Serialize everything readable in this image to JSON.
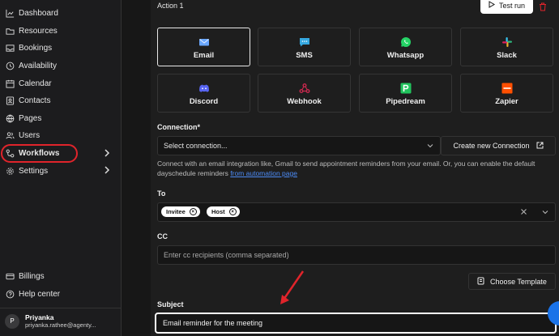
{
  "sidebar": {
    "items": [
      {
        "label": "Dashboard",
        "icon": "chart-icon"
      },
      {
        "label": "Resources",
        "icon": "folder-icon"
      },
      {
        "label": "Bookings",
        "icon": "inbox-icon"
      },
      {
        "label": "Availability",
        "icon": "clock-icon"
      },
      {
        "label": "Calendar",
        "icon": "calendar-icon"
      },
      {
        "label": "Contacts",
        "icon": "contact-icon"
      },
      {
        "label": "Pages",
        "icon": "globe-icon"
      },
      {
        "label": "Users",
        "icon": "users-icon"
      },
      {
        "label": "Workflows",
        "icon": "workflow-icon"
      },
      {
        "label": "Settings",
        "icon": "gear-icon"
      }
    ],
    "bottom_items": [
      {
        "label": "Billings",
        "icon": "card-icon"
      },
      {
        "label": "Help center",
        "icon": "help-icon"
      }
    ],
    "user": {
      "initial": "P",
      "name": "Priyanka",
      "email": "priyanka.rathee@agenty..."
    }
  },
  "main": {
    "action_title": "Action 1",
    "test_run_label": "Test run",
    "channels": [
      {
        "label": "Email",
        "icon": "email-icon",
        "color": "#6aa7ff"
      },
      {
        "label": "SMS",
        "icon": "sms-icon",
        "color": "#36a9e1"
      },
      {
        "label": "Whatsapp",
        "icon": "whatsapp-icon",
        "color": "#25d366"
      },
      {
        "label": "Slack",
        "icon": "slack-icon",
        "color": "#e01e5a"
      },
      {
        "label": "Discord",
        "icon": "discord-icon",
        "color": "#5865f2"
      },
      {
        "label": "Webhook",
        "icon": "webhook-icon",
        "color": "#c6284d"
      },
      {
        "label": "Pipedream",
        "icon": "pipedream-icon",
        "color": "#21c45d"
      },
      {
        "label": "Zapier",
        "icon": "zapier-icon",
        "color": "#ff4f00"
      }
    ],
    "connection": {
      "label": "Connection*",
      "placeholder": "Select connection...",
      "create_label": "Create new Connection",
      "hint_text": "Connect with an email integration like, Gmail to send appointment reminders from your email. Or, you can enable the default dayschedule reminders",
      "hint_link": "from automation page"
    },
    "to": {
      "label": "To",
      "chips": [
        "Invitee",
        "Host"
      ]
    },
    "cc": {
      "label": "CC",
      "placeholder": "Enter cc recipients (comma separated)"
    },
    "choose_template_label": "Choose Template",
    "subject": {
      "label": "Subject",
      "value": "Email reminder for the meeting"
    }
  },
  "colors": {
    "annotation": "#e0242b",
    "link": "#4c8bf5",
    "chat": "#1a73e8"
  }
}
